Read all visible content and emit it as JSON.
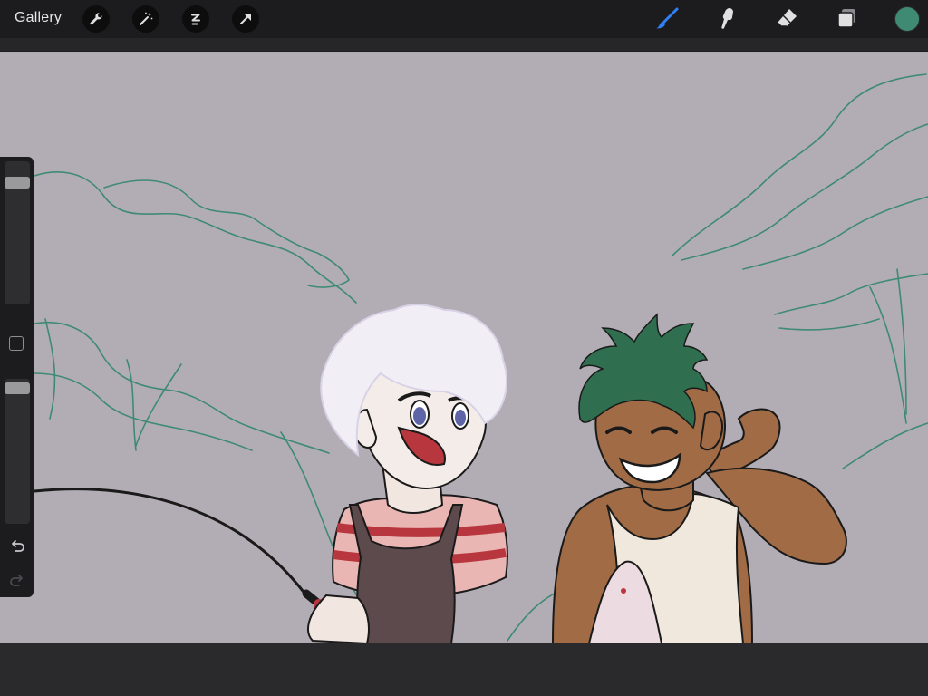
{
  "toolbar": {
    "gallery_label": "Gallery",
    "left_tools": [
      "wrench-icon",
      "magic-wand-icon",
      "selection-icon",
      "transform-arrow-icon"
    ],
    "right_tools": [
      "brush-icon",
      "smudge-icon",
      "eraser-icon",
      "layers-icon"
    ],
    "active_tool": "brush-icon",
    "active_color": "#3e8a73"
  },
  "sidebar": {
    "brush_size_level": 0.12,
    "opacity_level": 0.03,
    "controls": [
      "brush-size-slider",
      "modify-button",
      "opacity-slider",
      "undo-icon",
      "redo-icon"
    ]
  },
  "canvas": {
    "background_color": "#b2adb4",
    "sketch_line_color": "#3f8a74"
  }
}
